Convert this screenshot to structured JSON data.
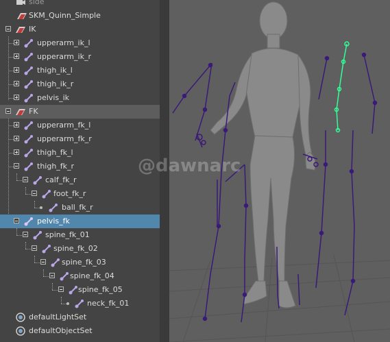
{
  "outliner": {
    "items": [
      {
        "label": "side"
      },
      {
        "label": "SKM_Quinn_Simple"
      },
      {
        "label": "IK"
      },
      {
        "label": "upperarm_ik_l"
      },
      {
        "label": "upperarm_ik_r"
      },
      {
        "label": "thigh_ik_l"
      },
      {
        "label": "thigh_ik_r"
      },
      {
        "label": "pelvis_ik"
      },
      {
        "label": "FK"
      },
      {
        "label": "upperarm_fk_l"
      },
      {
        "label": "upperarm_fk_r"
      },
      {
        "label": "thigh_fk_l"
      },
      {
        "label": "thigh_fk_r"
      },
      {
        "label": "calf_fk_r"
      },
      {
        "label": "foot_fk_r"
      },
      {
        "label": "ball_fk_r"
      },
      {
        "label": "pelvis_fk"
      },
      {
        "label": "spine_fk_01"
      },
      {
        "label": "spine_fk_02"
      },
      {
        "label": "spine_fk_03"
      },
      {
        "label": "spine_fk_04"
      },
      {
        "label": "spine_fk_05"
      },
      {
        "label": "neck_fk_01"
      },
      {
        "label": "defaultLightSet"
      },
      {
        "label": "defaultObjectSet"
      }
    ]
  },
  "watermark": "@dawnarc",
  "colors": {
    "panel_bg": "#444444",
    "selected_row": "#5287ad",
    "highlight_row": "#5d5d5d",
    "viewport_bg": "#5f5f5f",
    "joint_color": "#3a1a78",
    "selected_joint_color": "#33ff99"
  },
  "icons": {
    "camera": "camera-icon",
    "mesh": "mesh-icon",
    "group": "group-icon",
    "joint": "joint-icon",
    "set": "set-icon"
  }
}
